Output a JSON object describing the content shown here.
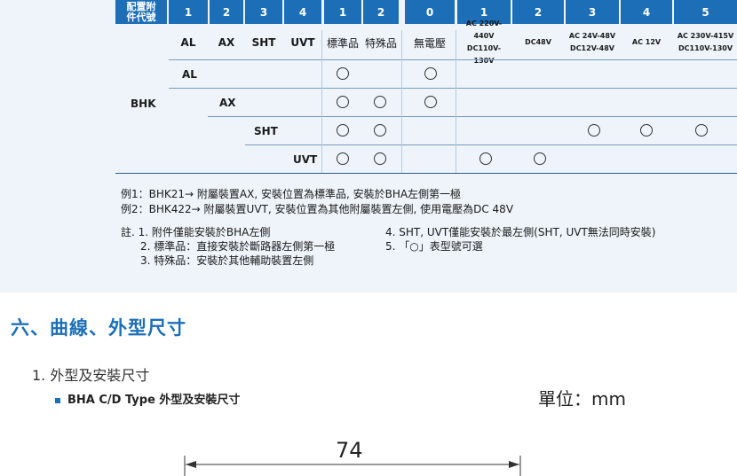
{
  "header": {
    "first_line1": "配置附",
    "first_line2": "件代號",
    "cells": [
      "1",
      "2",
      "3",
      "4",
      "1",
      "2",
      "0",
      "1",
      "2",
      "3",
      "4",
      "5"
    ]
  },
  "subheader": {
    "acc": [
      "AL",
      "AX",
      "SHT",
      "UVT"
    ],
    "pos": [
      "標準品",
      "特殊品"
    ],
    "volt0": "無電壓",
    "volt1": [
      "AC 220V-440V",
      "DC110V-130V"
    ],
    "volt2": "DC48V",
    "volt3": [
      "AC 24V-48V",
      "DC12V-48V"
    ],
    "volt4": "AC 12V",
    "volt5": [
      "AC 230V-415V",
      "DC110V-130V"
    ]
  },
  "rows": {
    "model": "BHK",
    "labels": [
      "AL",
      "AX",
      "SHT",
      "UVT"
    ]
  },
  "examples": [
    "例1：BHK21→ 附屬裝置AX, 安裝位置為標準品, 安裝於BHA左側第一極",
    "例2：BHK422→ 附屬裝置UVT, 安裝位置為其他附屬裝置左側, 使用電壓為DC 48V"
  ],
  "notes_left": [
    "註. 1. 附件僅能安裝於BHA左側",
    "2. 標準品：直接安裝於斷路器左側第一極",
    "3. 特殊品：安裝於其他輔助裝置左側"
  ],
  "notes_right": [
    "4. SHT, UVT僅能安裝於最左側(SHT, UVT無法同時安裝)",
    "5. 「○」表型號可選"
  ],
  "section_title": "六、曲線、外型尺寸",
  "subsection_title": "1. 外型及安裝尺寸",
  "figure_title": "BHA C/D Type 外型及安裝尺寸",
  "unit_label": "單位：mm",
  "dimension_value": "74",
  "colors": {
    "accent": "#1c6fb7",
    "panel_bg": "#eef4fa"
  }
}
